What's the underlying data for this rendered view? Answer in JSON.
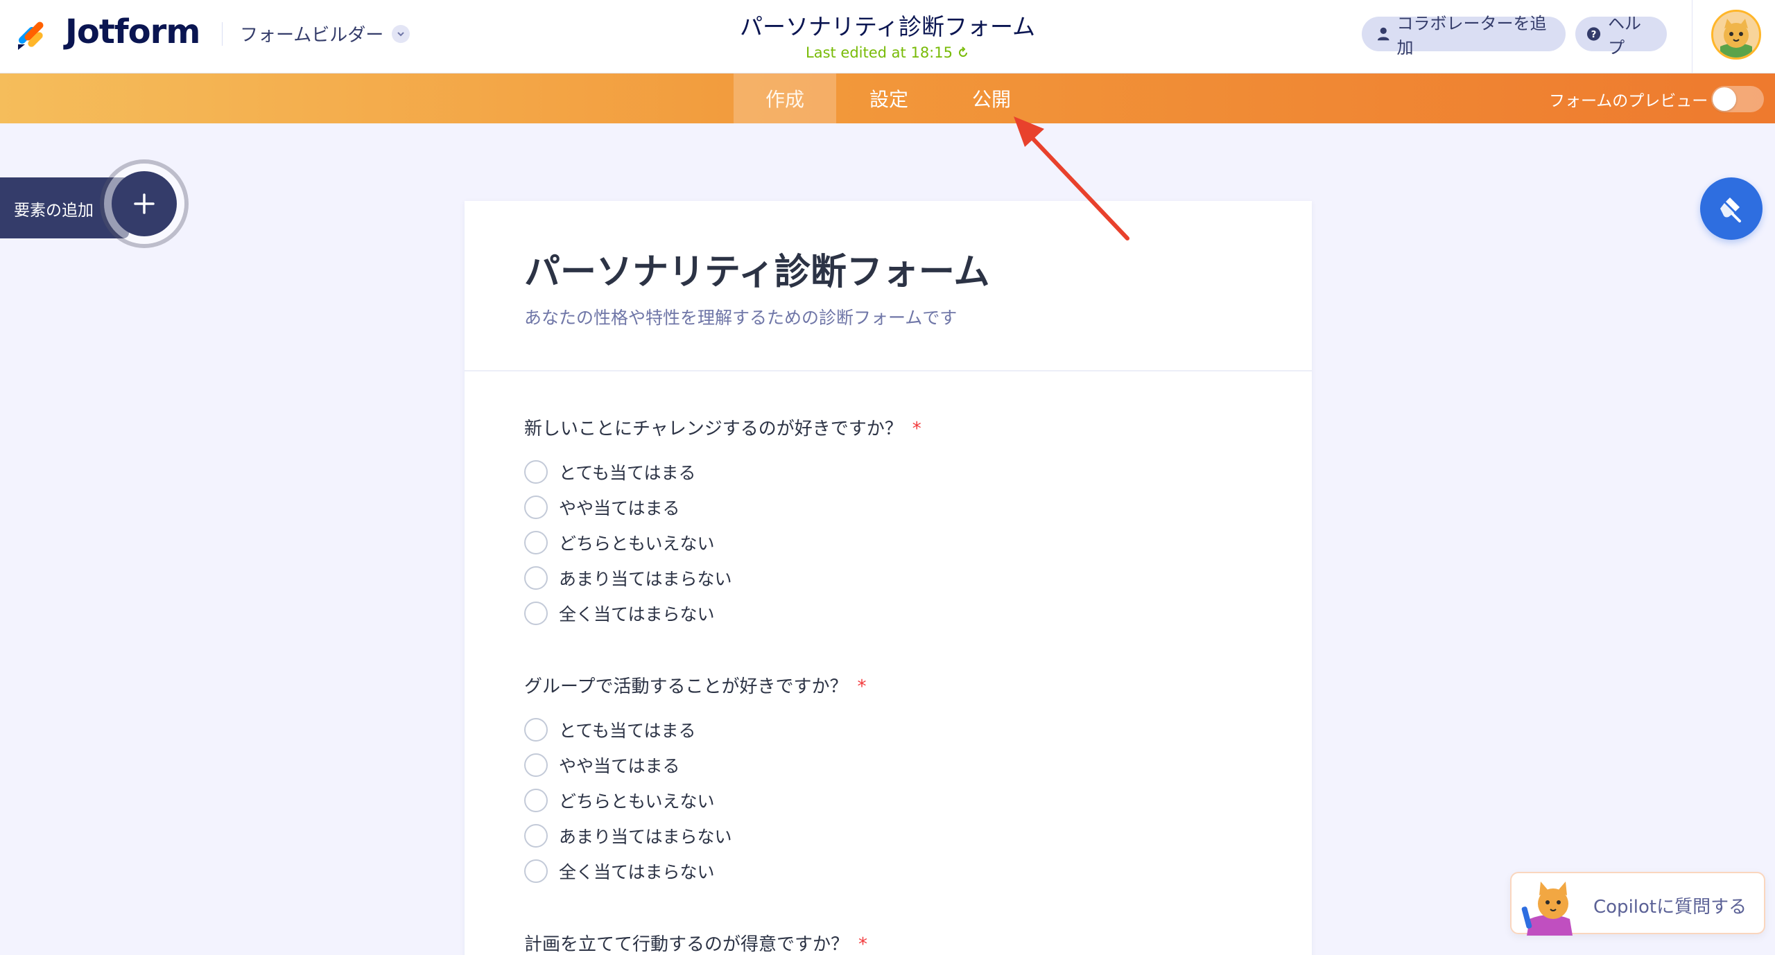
{
  "header": {
    "brand": "Jotform",
    "builder_menu": "フォームビルダー",
    "form_title": "パーソナリティ診断フォーム",
    "last_edited": "Last edited at 18:15",
    "collaborator_button": "コラボレーターを追加",
    "help_button": "ヘルプ"
  },
  "nav": {
    "tabs": [
      {
        "label": "作成",
        "active": true
      },
      {
        "label": "設定",
        "active": false
      },
      {
        "label": "公開",
        "active": false
      }
    ],
    "preview_label": "フォームのプレビュー",
    "preview_enabled": false
  },
  "left_panel": {
    "add_element_label": "要素の追加"
  },
  "form": {
    "title": "パーソナリティ診断フォーム",
    "subtitle": "あなたの性格や特性を理解するための診断フォームです",
    "questions": [
      {
        "label": "新しいことにチャレンジするのが好きですか？",
        "required": "*",
        "options": [
          "とても当てはまる",
          "やや当てはまる",
          "どちらともいえない",
          "あまり当てはまらない",
          "全く当てはまらない"
        ]
      },
      {
        "label": "グループで活動することが好きですか？",
        "required": "*",
        "options": [
          "とても当てはまる",
          "やや当てはまる",
          "どちらともいえない",
          "あまり当てはまらない",
          "全く当てはまらない"
        ]
      },
      {
        "label": "計画を立てて行動するのが得意ですか？",
        "required": "*"
      }
    ]
  },
  "copilot": {
    "label": "Copilotに質問する"
  },
  "colors": {
    "accent_orange": "#ee7a2e",
    "brand_navy": "#0a1551",
    "paint_button_blue": "#2e6ee0",
    "required_red": "#f23a3c",
    "annotation_arrow": "#e8412c"
  },
  "icons": {
    "logo": "jotform-logo-icon",
    "collaborator": "user-icon",
    "help": "question-circle-icon",
    "add": "plus-icon",
    "paint": "paint-roller-icon",
    "refresh": "refresh-icon",
    "dropdown": "chevron-down-icon"
  }
}
